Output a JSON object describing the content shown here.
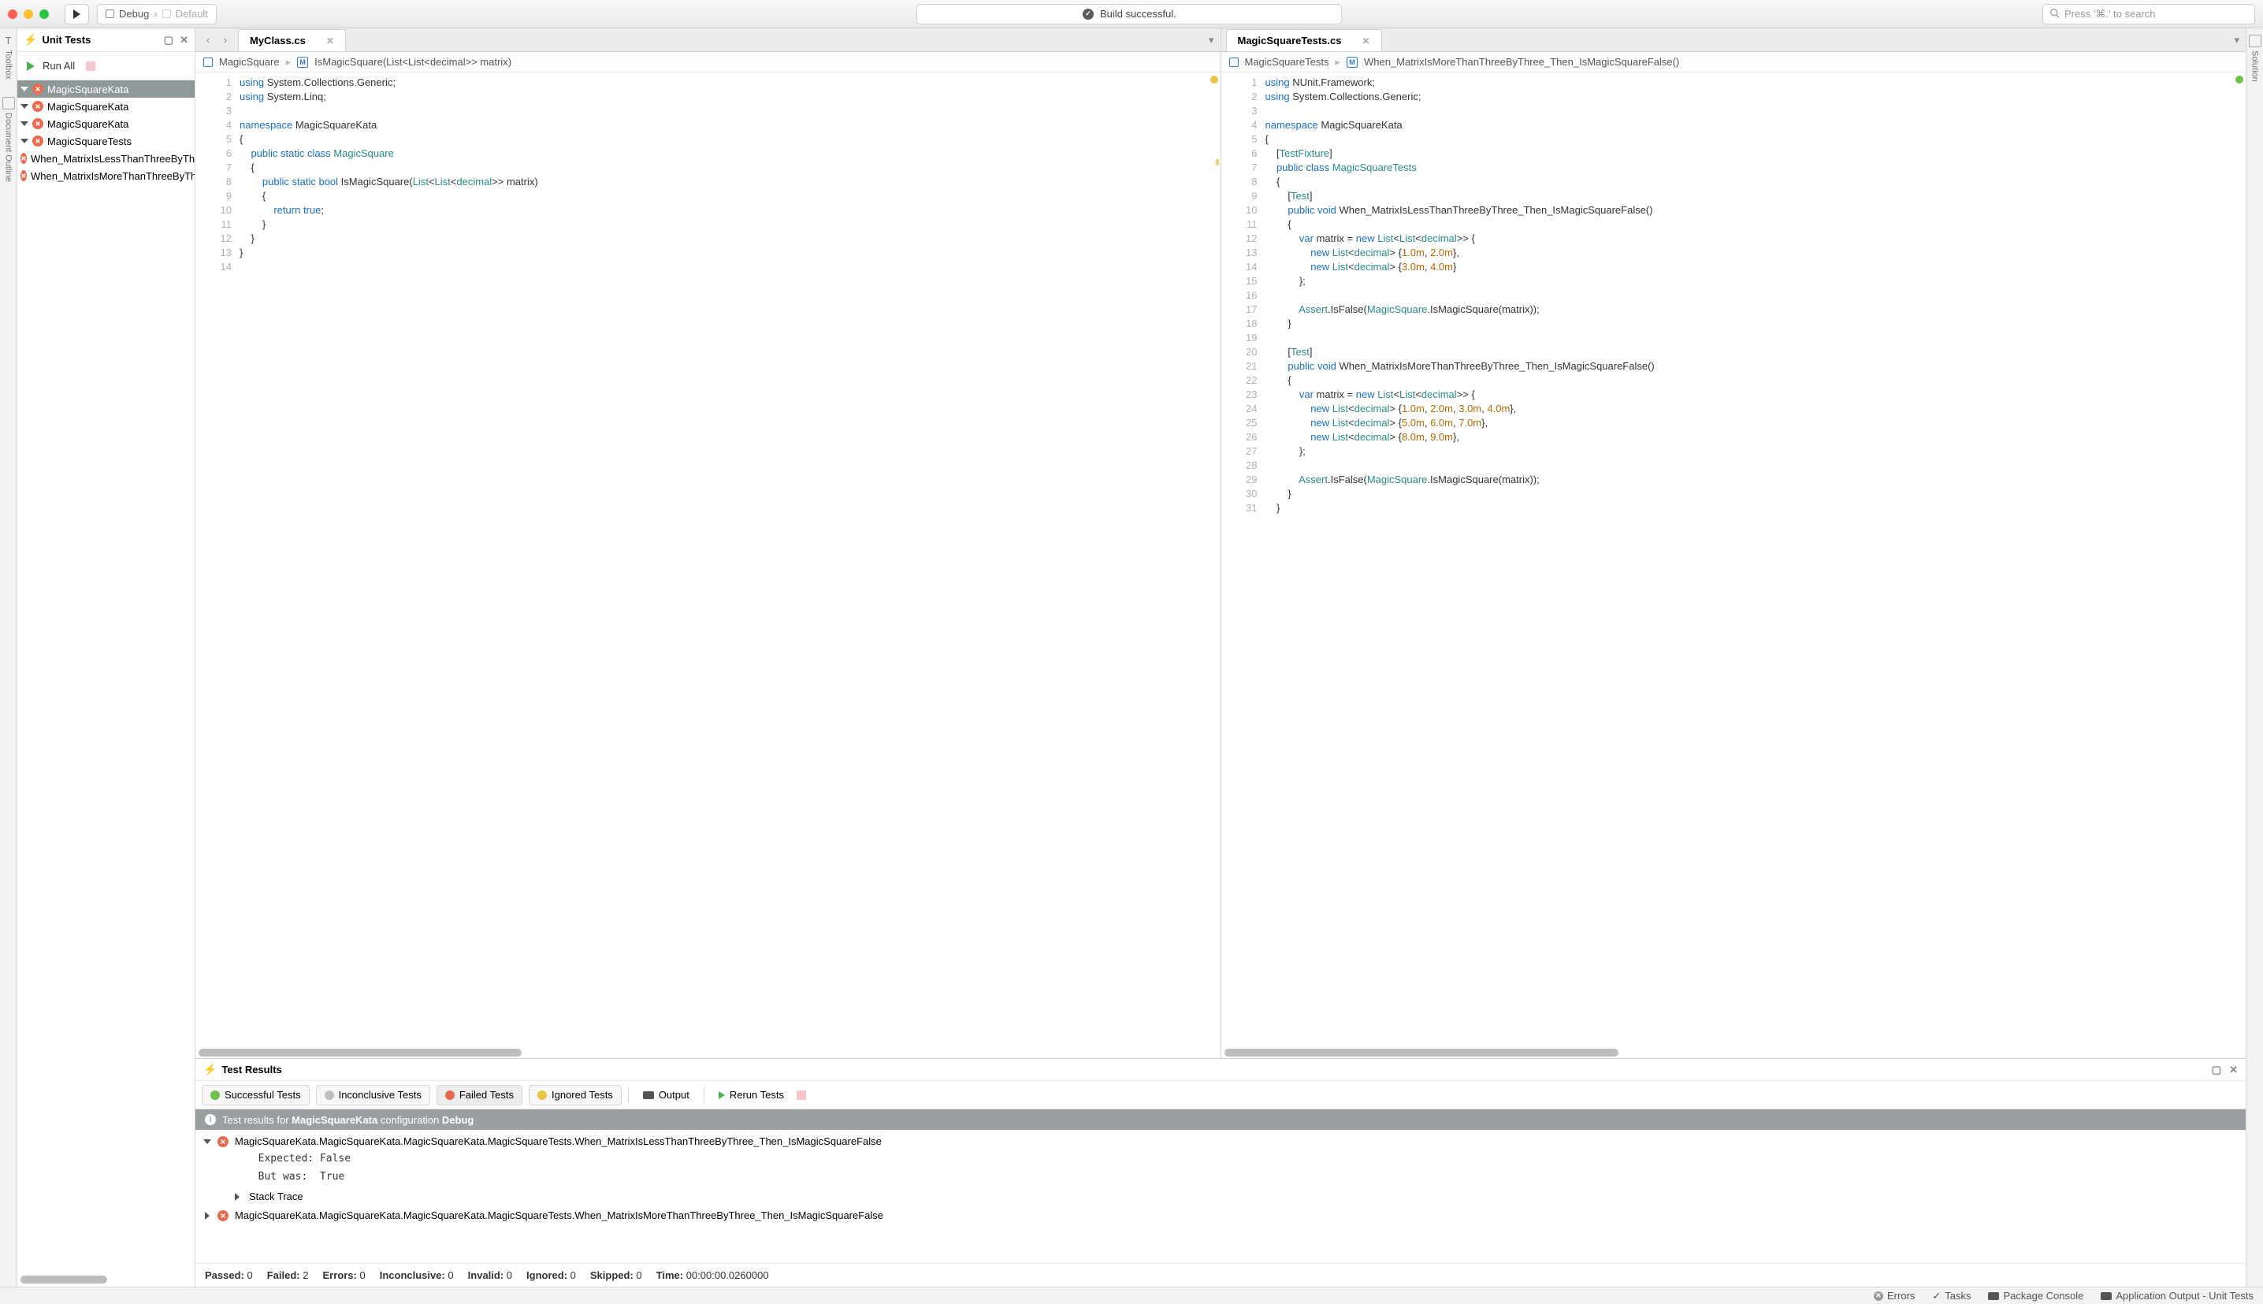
{
  "titlebar": {
    "config_label": "Debug",
    "target_label": "Default",
    "build_status": "Build successful.",
    "search_placeholder": "Press '⌘.' to search"
  },
  "left_rail": {
    "toolbox": "Toolbox",
    "doc_outline": "Document Outline"
  },
  "right_rail": {
    "solution": "Solution"
  },
  "unit_tests_panel": {
    "title": "Unit Tests",
    "run_all": "Run All",
    "tree": {
      "root": "MagicSquareKata",
      "lvl1": "MagicSquareKata",
      "lvl2": "MagicSquareKata",
      "lvl3": "MagicSquareTests",
      "t1": "When_MatrixIsLessThanThreeByThree_Then_IsMagicSquareFalse",
      "t2": "When_MatrixIsMoreThanThreeByThree_Then_IsMagicSquareFalse"
    }
  },
  "editor_left": {
    "tab": "MyClass.cs",
    "bc_proj": "MagicSquare",
    "bc_method": "IsMagicSquare(List<List<decimal>> matrix)"
  },
  "editor_right": {
    "tab": "MagicSquareTests.cs",
    "bc_proj": "MagicSquareTests",
    "bc_method": "When_MatrixIsMoreThanThreeByThree_Then_IsMagicSquareFalse()"
  },
  "test_results": {
    "title": "Test Results",
    "filters": {
      "success": "Successful Tests",
      "inconclusive": "Inconclusive Tests",
      "failed": "Failed Tests",
      "ignored": "Ignored Tests",
      "output": "Output",
      "rerun": "Rerun Tests"
    },
    "banner_prefix": "Test results for ",
    "banner_target": "MagicSquareKata",
    "banner_mid": " configuration ",
    "banner_cfg": "Debug",
    "fail1": "MagicSquareKata.MagicSquareKata.MagicSquareKata.MagicSquareTests.When_MatrixIsLessThanThreeByThree_Then_IsMagicSquareFalse",
    "fail1_expected": "  Expected: False",
    "fail1_butwas": "  But was:  True",
    "stack": "Stack Trace",
    "fail2": "MagicSquareKata.MagicSquareKata.MagicSquareKata.MagicSquareTests.When_MatrixIsMoreThanThreeByThree_Then_IsMagicSquareFalse",
    "summary": {
      "passed_l": "Passed:",
      "passed_v": "0",
      "failed_l": "Failed:",
      "failed_v": "2",
      "errors_l": "Errors:",
      "errors_v": "0",
      "inc_l": "Inconclusive:",
      "inc_v": "0",
      "inv_l": "Invalid:",
      "inv_v": "0",
      "ign_l": "Ignored:",
      "ign_v": "0",
      "skip_l": "Skipped:",
      "skip_v": "0",
      "time_l": "Time:",
      "time_v": "00:00:00.0260000"
    }
  },
  "statusbar": {
    "errors": "Errors",
    "tasks": "Tasks",
    "pkg": "Package Console",
    "output": "Application Output - Unit Tests"
  }
}
